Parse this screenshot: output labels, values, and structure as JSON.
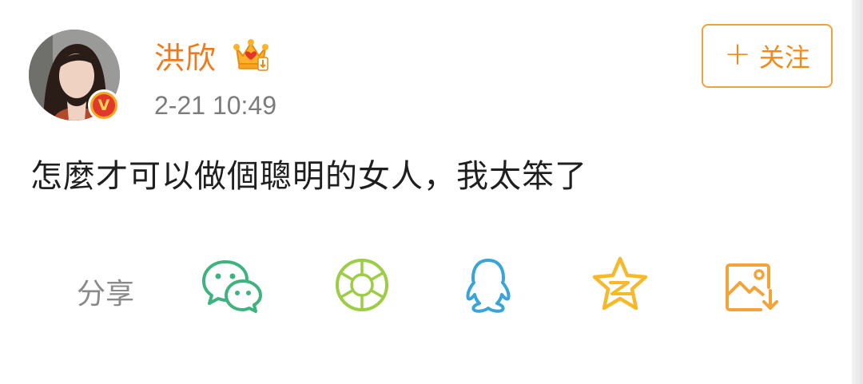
{
  "post": {
    "user_name": "洪欣",
    "time": "2-21 10:49",
    "text": "怎麼才可以做個聰明的女人，我太笨了",
    "verified_badge": "V"
  },
  "follow_button": {
    "plus": "+",
    "label": "关注"
  },
  "share": {
    "label": "分享",
    "icons": [
      "wechat-icon",
      "moments-icon",
      "qq-icon",
      "qzone-icon",
      "save-image-icon"
    ]
  },
  "colors": {
    "name": "#ee7a1b",
    "follow": "#f08a1a",
    "wechat": "#3fb37f",
    "moments": "#9ccd44",
    "qq": "#39a4d8",
    "qzone": "#f5b92a",
    "save": "#f2a33a"
  }
}
